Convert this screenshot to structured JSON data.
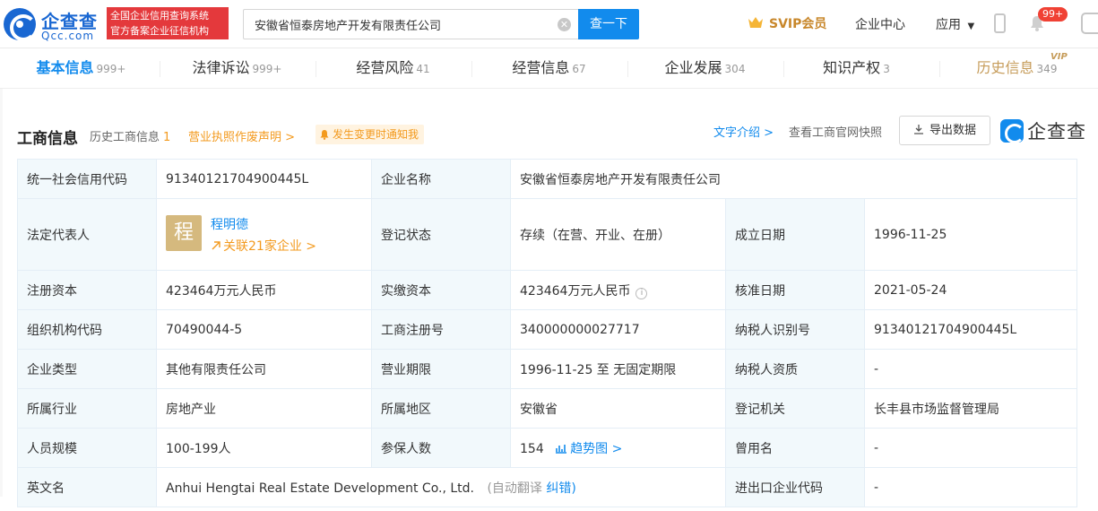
{
  "header": {
    "logo_cn": "企查查",
    "logo_en": "Qcc.com",
    "slogan_line1": "全国企业信用查询系统",
    "slogan_line2": "官方备案企业征信机构",
    "search_value": "安徽省恒泰房地产开发有限责任公司",
    "search_button": "查一下",
    "svip_label": "SVIP会员",
    "enterprise_center": "企业中心",
    "apps_label": "应用",
    "notification_badge": "99+"
  },
  "tabs": [
    {
      "label": "基本信息",
      "count": "999+"
    },
    {
      "label": "法律诉讼",
      "count": "999+"
    },
    {
      "label": "经营风险",
      "count": "41"
    },
    {
      "label": "经营信息",
      "count": "67"
    },
    {
      "label": "企业发展",
      "count": "304"
    },
    {
      "label": "知识产权",
      "count": "3"
    },
    {
      "label": "历史信息",
      "count": "349"
    }
  ],
  "vip_tag": "VIP",
  "section": {
    "title": "工商信息",
    "history_label": "历史工商信息",
    "history_count": "1",
    "license_link": "营业执照作废声明 >",
    "notify_label": "发生变更时通知我",
    "text_intro": "文字介绍 >",
    "snapshot": "查看工商官网快照",
    "export_button": "导出数据",
    "brand": "企查查"
  },
  "table": {
    "credit_code_label": "统一社会信用代码",
    "credit_code": "91340121704900445L",
    "company_name_label": "企业名称",
    "company_name": "安徽省恒泰房地产开发有限责任公司",
    "legal_rep_label": "法定代表人",
    "legal_rep_avatar": "程",
    "legal_rep_name": "程明德",
    "legal_rep_related": "关联21家企业 >",
    "reg_status_label": "登记状态",
    "reg_status": "存续（在营、开业、在册）",
    "found_date_label": "成立日期",
    "found_date": "1996-11-25",
    "reg_capital_label": "注册资本",
    "reg_capital": "423464万元人民币",
    "paid_capital_label": "实缴资本",
    "paid_capital": "423464万元人民币",
    "approve_date_label": "核准日期",
    "approve_date": "2021-05-24",
    "org_code_label": "组织机构代码",
    "org_code": "70490044-5",
    "biz_reg_no_label": "工商注册号",
    "biz_reg_no": "340000000027717",
    "taxpayer_id_label": "纳税人识别号",
    "taxpayer_id": "91340121704900445L",
    "company_type_label": "企业类型",
    "company_type": "其他有限责任公司",
    "biz_term_label": "营业期限",
    "biz_term": "1996-11-25 至 无固定期限",
    "taxpayer_qual_label": "纳税人资质",
    "taxpayer_qual": "-",
    "industry_label": "所属行业",
    "industry": "房地产业",
    "region_label": "所属地区",
    "region": "安徽省",
    "reg_authority_label": "登记机关",
    "reg_authority": "长丰县市场监督管理局",
    "staff_size_label": "人员规模",
    "staff_size": "100-199人",
    "insured_label": "参保人数",
    "insured": "154",
    "trend_label": "趋势图 >",
    "former_name_label": "曾用名",
    "former_name": "-",
    "english_name_label": "英文名",
    "english_name": "Anhui Hengtai Real Estate Development Co., Ltd.",
    "auto_translate": "(自动翻译",
    "correction": "纠错)",
    "import_export_label": "进出口企业代码",
    "import_export": "-"
  }
}
